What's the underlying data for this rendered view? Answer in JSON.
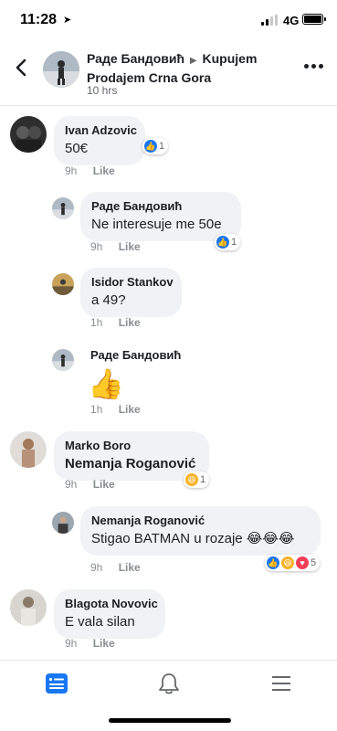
{
  "status_bar": {
    "time": "11:28",
    "network": "4G"
  },
  "header": {
    "title_part1": "Раде Бандовић",
    "title_part2": "Kupujem Prodajem Crna Gora",
    "time": "10 hrs"
  },
  "comments": [
    {
      "author": "Ivan Adzovic",
      "text": "50€",
      "time": "9h",
      "like": "Like",
      "reaction_count": "1"
    },
    {
      "author": "Раде Бандовић",
      "text": "Ne interesuje me 50e",
      "time": "9h",
      "like": "Like",
      "reaction_count": "1"
    },
    {
      "author": "Isidor Stankov",
      "text": "a 49?",
      "time": "1h",
      "like": "Like"
    },
    {
      "author": "Раде Бандовић",
      "text": "👍",
      "time": "1h",
      "like": "Like"
    },
    {
      "author": "Marko Boro",
      "text": "Nemanja Roganović",
      "time": "9h",
      "like": "Like",
      "reaction_count": "1"
    },
    {
      "author": "Nemanja Roganović",
      "text": "Stigao BATMAN u rozaje 😂😂😂",
      "time": "9h",
      "like": "Like",
      "reaction_count": "5"
    },
    {
      "author": "Blagota Novovic",
      "text": "E vala silan",
      "time": "9h",
      "like": "Like"
    }
  ],
  "colors": {
    "accent": "#1877f2",
    "bubble": "#f0f2f5",
    "meta": "#8a8d91"
  },
  "icons": [
    "back-arrow-icon",
    "more-icon",
    "like-reaction-icon",
    "haha-reaction-icon",
    "love-reaction-icon",
    "news-feed-icon",
    "notifications-bell-icon",
    "menu-icon"
  ]
}
